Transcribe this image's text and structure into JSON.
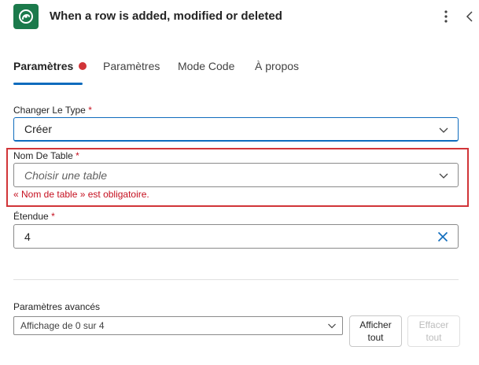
{
  "header": {
    "title": "When a row is added, modified or deleted",
    "icon": "dataverse-icon",
    "brand_color": "#1b7a4b"
  },
  "tabs": [
    {
      "label": "Paramètres",
      "active": true,
      "has_error": true
    },
    {
      "label": "Paramètres",
      "active": false
    },
    {
      "label": "Mode Code",
      "active": false
    },
    {
      "label": "À propos",
      "active": false
    }
  ],
  "fields": {
    "change_type": {
      "label": "Changer Le Type",
      "required": "*",
      "value": "Créer"
    },
    "table_name": {
      "label": "Nom De Table",
      "required": "*",
      "placeholder": "Choisir une table",
      "error": "« Nom de table » est obligatoire."
    },
    "scope": {
      "label": "Étendue",
      "required": "*",
      "value": "4"
    }
  },
  "advanced": {
    "label": "Paramètres avancés",
    "select_value": "Affichage de 0 sur 4",
    "show_all": {
      "line1": "Afficher",
      "line2": "tout"
    },
    "clear_all": {
      "line1": "Effacer",
      "line2": "tout"
    }
  },
  "colors": {
    "accent": "#0f6cbd",
    "error": "#d13438"
  }
}
